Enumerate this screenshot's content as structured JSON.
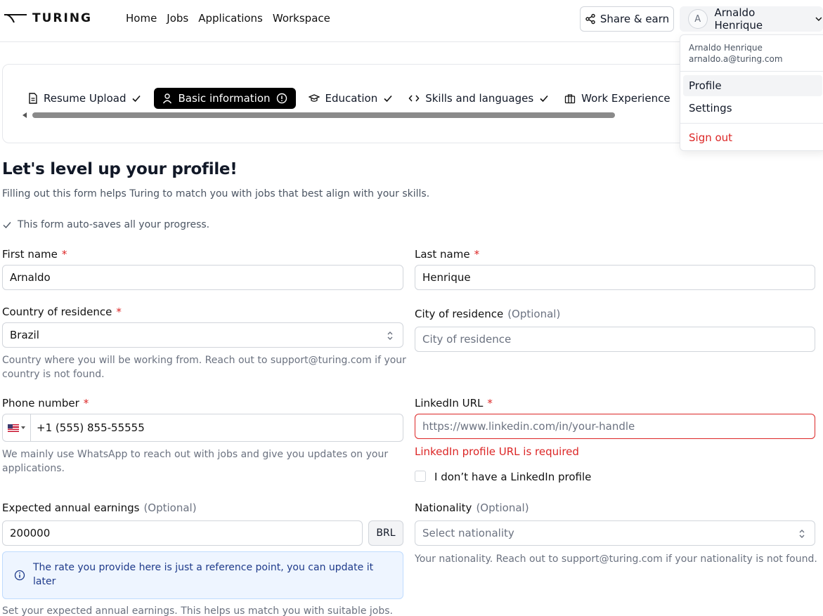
{
  "header": {
    "logo_text": "TURING",
    "nav": [
      "Home",
      "Jobs",
      "Applications",
      "Workspace"
    ],
    "share_label": "Share & earn",
    "user_initial": "A",
    "user_name": "Arnaldo Henrique"
  },
  "menu": {
    "name": "Arnaldo Henrique",
    "email": "arnaldo.a@turing.com",
    "items": [
      "Profile",
      "Settings"
    ],
    "signout": "Sign out"
  },
  "stepper": {
    "steps": [
      {
        "label": "Resume Upload",
        "status": "done"
      },
      {
        "label": "Basic information",
        "status": "active"
      },
      {
        "label": "Education",
        "status": "done"
      },
      {
        "label": "Skills and languages",
        "status": "done"
      },
      {
        "label": "Work Experience",
        "status": "none"
      }
    ]
  },
  "page": {
    "title": "Let's level up your profile!",
    "subtitle": "Filling out this form helps Turing to match you with jobs that best align with your skills.",
    "autosave": "This form auto-saves all your progress."
  },
  "form": {
    "required_mark": "*",
    "optional_mark": "(Optional)",
    "first_name": {
      "label": "First name",
      "value": "Arnaldo"
    },
    "last_name": {
      "label": "Last name",
      "value": "Henrique"
    },
    "country": {
      "label": "Country of residence",
      "value": "Brazil",
      "help": "Country where you will be working from. Reach out to support@turing.com if your country is not found."
    },
    "city": {
      "label": "City of residence",
      "placeholder": "City of residence"
    },
    "phone": {
      "label": "Phone number",
      "value": "+1 (555) 855-55555",
      "help": "We mainly use WhatsApp to reach out with jobs and give you updates on your applications."
    },
    "linkedin": {
      "label": "LinkedIn URL",
      "placeholder": "https://www.linkedin.com/in/your-handle",
      "error": "LinkedIn profile URL is required",
      "no_profile": "I don’t have a LinkedIn profile"
    },
    "earnings": {
      "label": "Expected annual earnings",
      "value": "200000",
      "currency": "BRL",
      "info": "The rate you provide here is just a reference point, you can update it later",
      "help": "Set your expected annual earnings. This helps us match you with suitable jobs."
    },
    "nationality": {
      "label": "Nationality",
      "placeholder": "Select nationality",
      "help": "Your nationality. Reach out to support@turing.com if your nationality is not found."
    }
  },
  "colors": {
    "accent": "#000000",
    "error": "#dc2626",
    "info_bg": "#eef5ff"
  }
}
